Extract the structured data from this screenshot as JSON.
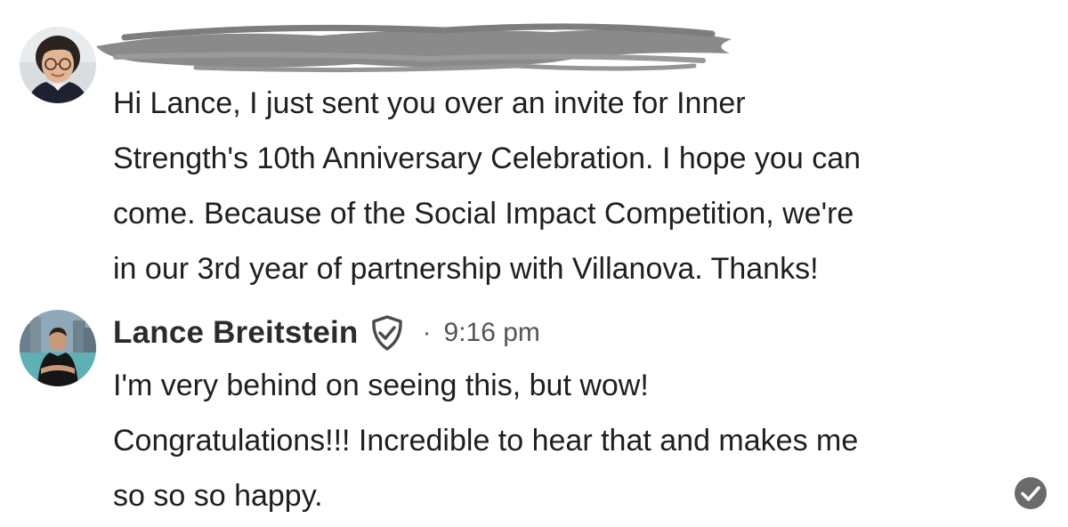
{
  "thread": {
    "messages": [
      {
        "sender": "",
        "sender_redacted": true,
        "time": "",
        "avatar": "avatar-woman-glasses",
        "lines": [
          "Hi Lance, I just sent you over an invite for Inner",
          "Strength's 10th Anniversary Celebration. I hope you can",
          "come. Because of the Social Impact Competition, we're",
          "in our 3rd year of partnership with Villanova. Thanks!"
        ]
      },
      {
        "sender": "Lance Breitstein",
        "verified_icon": "shield-check-icon",
        "separator": "·",
        "time": "9:16 pm",
        "avatar": "avatar-man-city",
        "lines": [
          "I'm very behind on seeing this, but wow!",
          "Congratulations!!! Incredible to hear that and makes me",
          "so so so happy."
        ]
      }
    ],
    "read_receipt_icon": "check-circle-icon"
  },
  "colors": {
    "text": "#1f1f1f",
    "muted": "#555555",
    "redaction": "#8a8a8a",
    "read_receipt": "#6b6b6b"
  }
}
